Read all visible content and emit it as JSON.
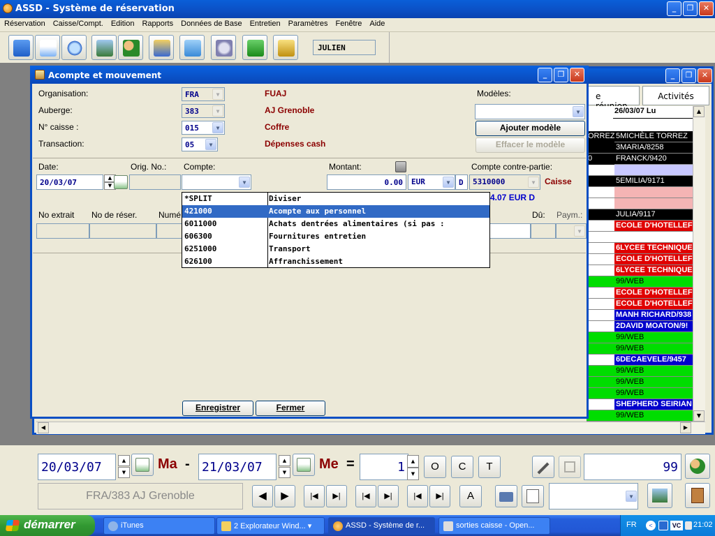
{
  "app": {
    "title": "ASSD - Système de réservation"
  },
  "menu": [
    "Réservation",
    "Caisse/Compt.",
    "Edition",
    "Rapports",
    "Données de Base",
    "Entretien",
    "Paramètres",
    "Fenêtre",
    "Aide"
  ],
  "toolbar": {
    "user": "JULIEN"
  },
  "background_window": {
    "tabs": [
      "e réunion",
      "Activités"
    ],
    "column_header": "26/03/07 Lu",
    "left_fragments": [
      "ORREZ",
      "0"
    ],
    "rows": [
      {
        "text": "5MICHÈLE TORREZ",
        "bg": "#000000",
        "fg": "#ffffff"
      },
      {
        "text": "3MARIA/8258",
        "bg": "#000000",
        "fg": "#ffffff"
      },
      {
        "text": "FRANCK/9420",
        "bg": "#000000",
        "fg": "#ffffff"
      },
      {
        "text": "",
        "bg": "#c8c8ff",
        "fg": "#000000"
      },
      {
        "text": "5EMILIA/9171",
        "bg": "#000000",
        "fg": "#ffffff"
      },
      {
        "text": "",
        "bg": "#f4b4b4",
        "fg": "#000000"
      },
      {
        "text": "",
        "bg": "#f4b4b4",
        "fg": "#000000"
      },
      {
        "text": "JULIA/9117",
        "bg": "#000000",
        "fg": "#ffffff"
      },
      {
        "text": "ECOLE D'HOTELLEF",
        "bg": "#e00000",
        "fg": "#ffffff"
      },
      {
        "text": "",
        "bg": "#ffffff",
        "fg": "#000000"
      },
      {
        "text": "6LYCEE TECHNIQUE",
        "bg": "#e00000",
        "fg": "#ffffff"
      },
      {
        "text": "ECOLE D'HOTELLEF",
        "bg": "#e00000",
        "fg": "#ffffff"
      },
      {
        "text": "6LYCEE TECHNIQUE",
        "bg": "#e00000",
        "fg": "#ffffff"
      },
      {
        "text": "99/WEB",
        "bg": "#00dd00",
        "fg": "#000000"
      },
      {
        "text": "ECOLE D'HOTELLEF",
        "bg": "#e00000",
        "fg": "#ffffff"
      },
      {
        "text": "ECOLE D'HOTELLEF",
        "bg": "#e00000",
        "fg": "#ffffff"
      },
      {
        "text": "MANH RICHARD/938",
        "bg": "#0000cc",
        "fg": "#ffffff"
      },
      {
        "text": "2DAVID MOATON/9!",
        "bg": "#0000cc",
        "fg": "#ffffff"
      },
      {
        "text": "99/WEB",
        "bg": "#00dd00",
        "fg": "#000000"
      },
      {
        "text": "99/WEB",
        "bg": "#00dd00",
        "fg": "#000000"
      },
      {
        "text": "6DECAEVELE/9457",
        "bg": "#0000cc",
        "fg": "#ffffff"
      },
      {
        "text": "99/WEB",
        "bg": "#00dd00",
        "fg": "#000000"
      },
      {
        "text": "99/WEB",
        "bg": "#00dd00",
        "fg": "#000000"
      },
      {
        "text": "99/WEB",
        "bg": "#00dd00",
        "fg": "#000000"
      },
      {
        "text": "SHEPHERD SEIRIAN",
        "bg": "#0000cc",
        "fg": "#ffffff"
      },
      {
        "text": "99/WEB",
        "bg": "#00dd00",
        "fg": "#000000"
      }
    ]
  },
  "dialog": {
    "title": "Acompte et mouvement",
    "labels": {
      "organisation": "Organisation:",
      "auberge": "Auberge:",
      "caisse": "N° caisse :",
      "transaction": "Transaction:",
      "modeles": "Modèles:",
      "date": "Date:",
      "orig": "Orig. No.:",
      "compte": "Compte:",
      "montant": "Montant:",
      "contre": "Compte contre-partie:",
      "extrait": "No extrait",
      "reser": "No de réser.",
      "numero": "Numé",
      "du": "Dû:",
      "paym": "Paym.:"
    },
    "values": {
      "organisation": "FRA",
      "auberge": "383",
      "caisse": "015",
      "transaction": "05",
      "date": "20/03/07",
      "montant": "0.00",
      "currency": "EUR",
      "dc": "D",
      "contre": "5310000",
      "contre_label": "Caisse",
      "balance": "4.07 EUR D"
    },
    "names": {
      "organisation": "FUAJ",
      "auberge": "AJ Grenoble",
      "caisse": "Coffre",
      "transaction": "Dépenses cash"
    },
    "buttons": {
      "ajouter": "Ajouter modèle",
      "effacer": "Effacer le modèle",
      "enregistrer": "Enregistrer",
      "fermer": "Fermer"
    },
    "dropdown": [
      {
        "code": "*SPLIT",
        "label": "Diviser"
      },
      {
        "code": "421000",
        "label": "Acompte aux personnel"
      },
      {
        "code": "6011000",
        "label": "Achats dentrées alimentaires (si pas :"
      },
      {
        "code": "606300",
        "label": "Fournitures entretien"
      },
      {
        "code": "6251000",
        "label": "Transport"
      },
      {
        "code": "626100",
        "label": "Affranchissement"
      }
    ],
    "selected_index": 1
  },
  "bottom": {
    "date_from": "20/03/07",
    "day_from": "Ma",
    "dash": "-",
    "date_to": "21/03/07",
    "day_to": "Me",
    "eq": "=",
    "count": "1",
    "btn_o": "O",
    "btn_c": "C",
    "btn_t": "T",
    "btn_a": "A",
    "total": "99",
    "hostel": "FRA/383 AJ Grenoble"
  },
  "taskbar": {
    "start": "démarrer",
    "tasks": [
      "iTunes",
      "2 Explorateur Wind...",
      "ASSD - Système de r...",
      "sorties caisse - Open..."
    ],
    "lang": "FR",
    "clock": "21:02"
  },
  "colors": {
    "accent": "#0a4fc4",
    "name_red": "#8b0000",
    "value_blue": "#00008b",
    "selection": "#316ac5"
  }
}
